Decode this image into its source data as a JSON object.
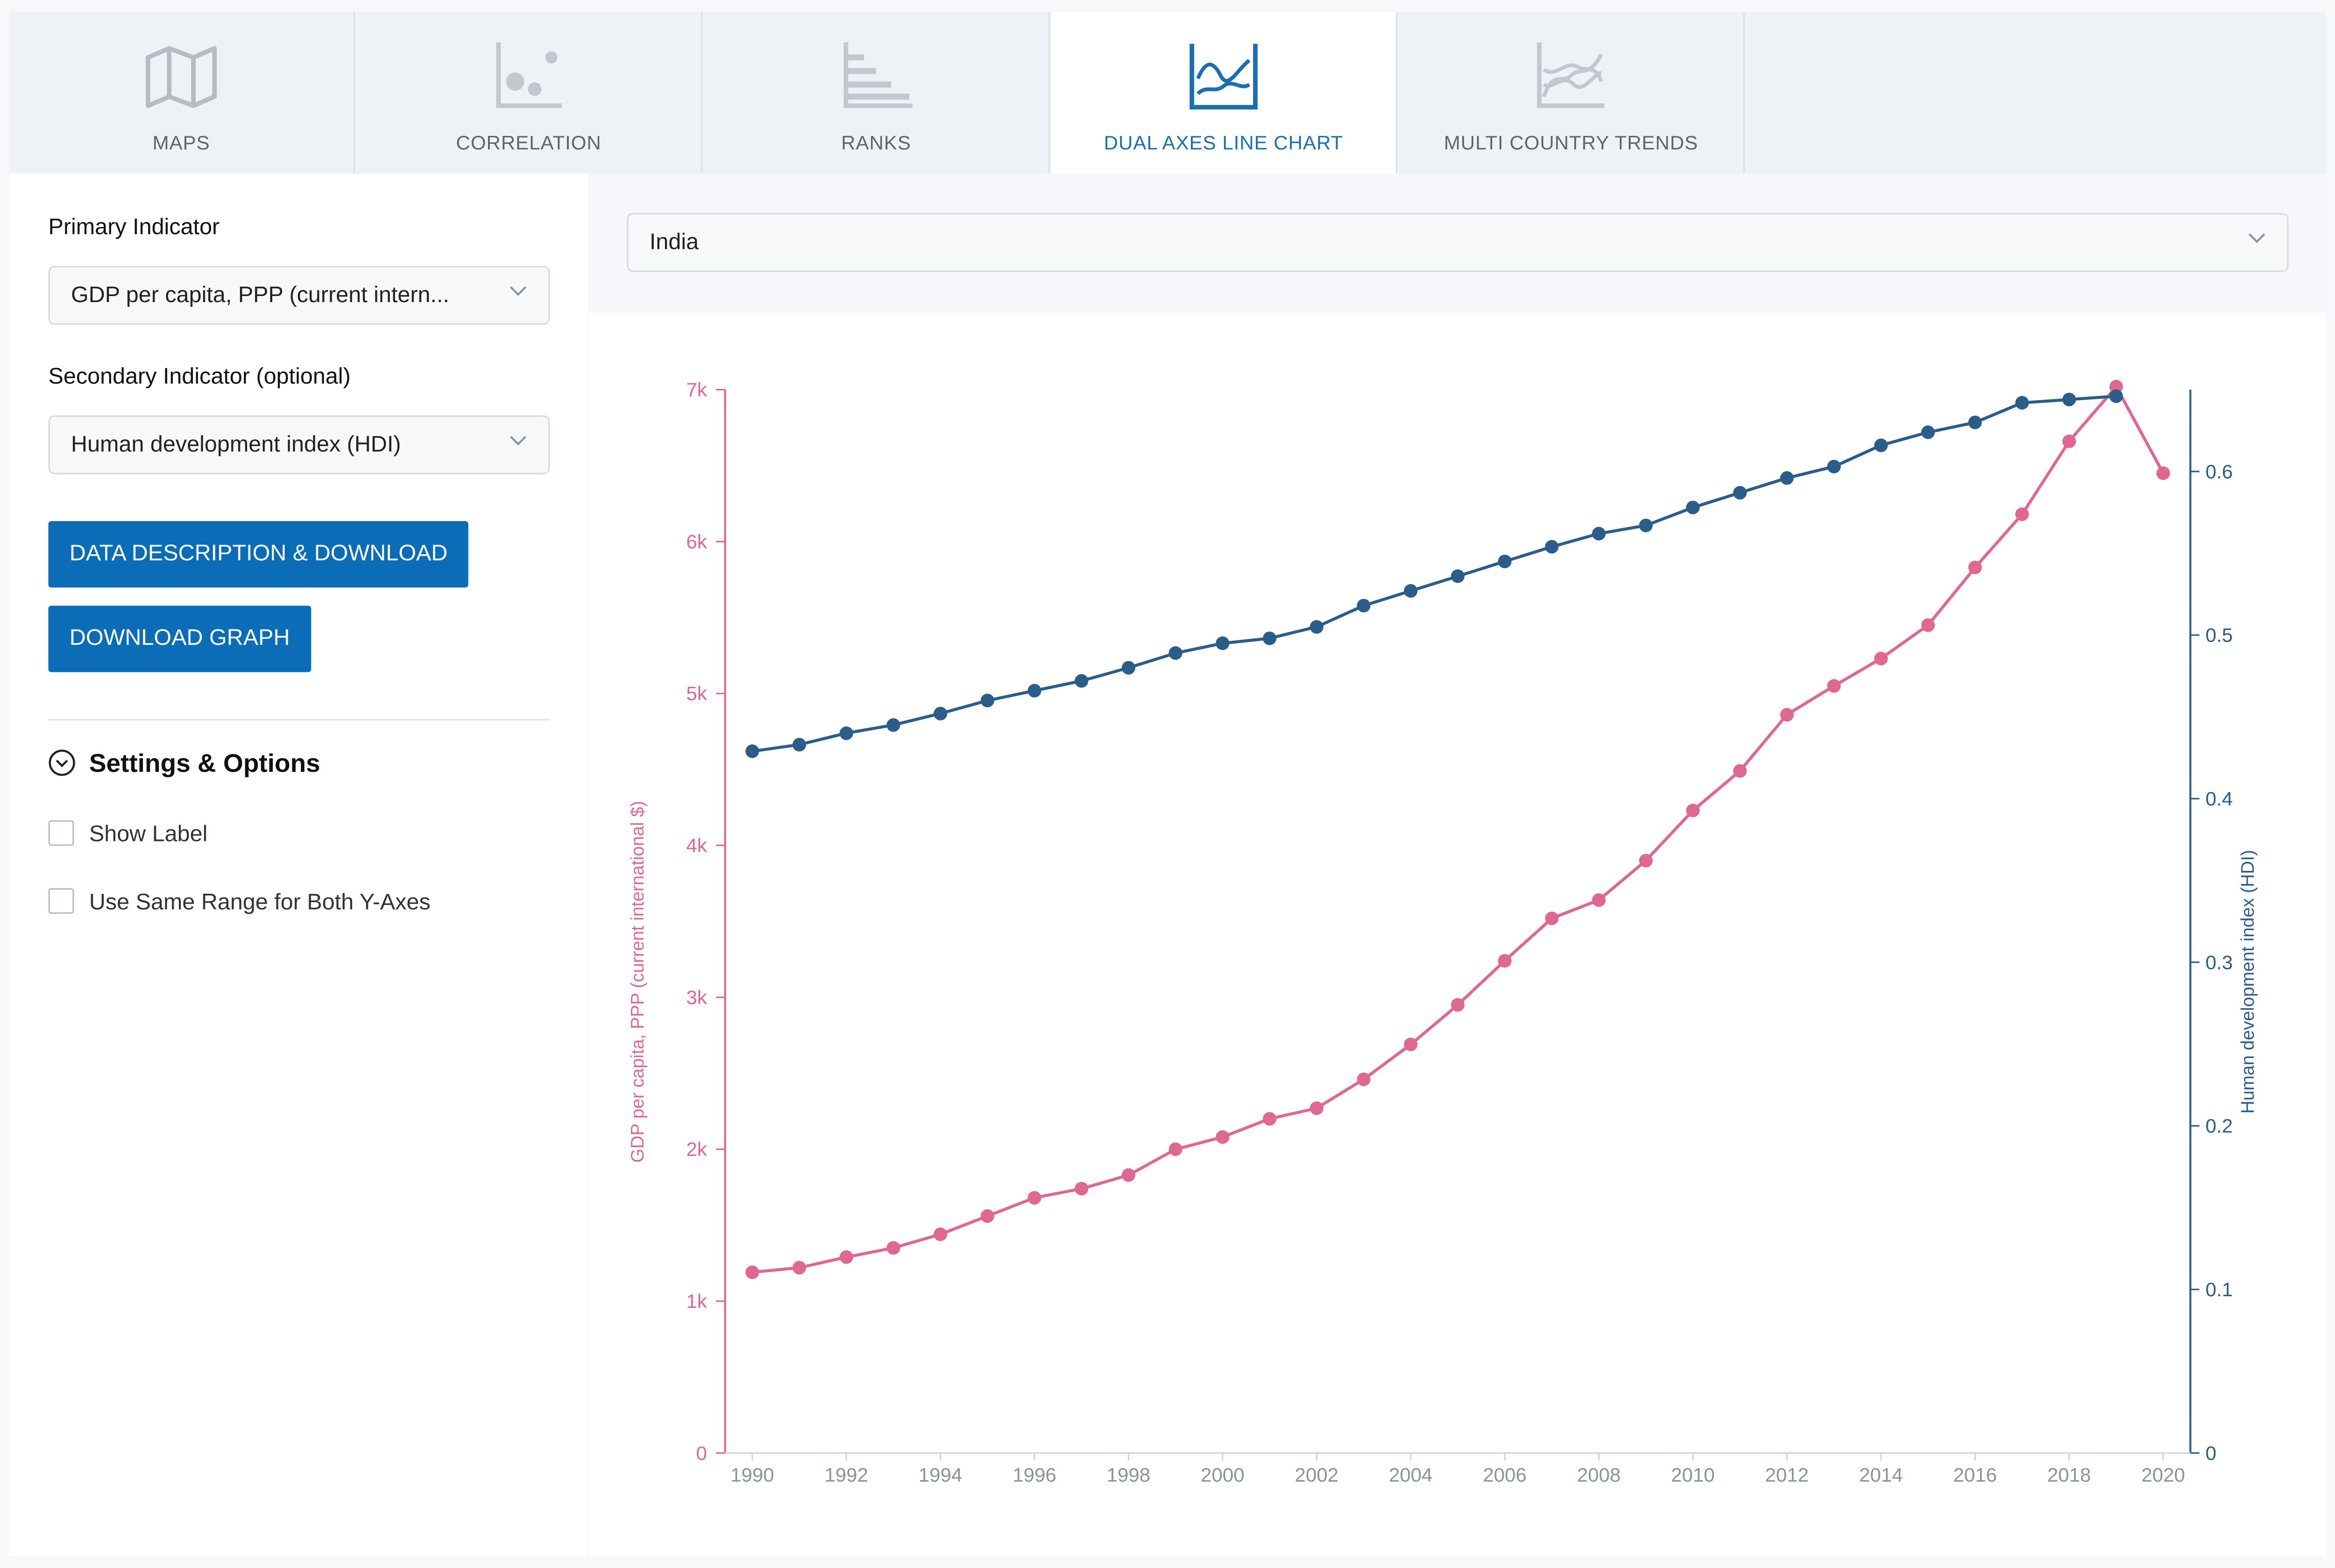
{
  "tabs": [
    {
      "label": "MAPS",
      "icon": "map-icon"
    },
    {
      "label": "CORRELATION",
      "icon": "scatter-icon"
    },
    {
      "label": "RANKS",
      "icon": "ranks-icon"
    },
    {
      "label": "DUAL AXES LINE CHART",
      "icon": "dual-axes-line-chart-icon",
      "active": true
    },
    {
      "label": "MULTI COUNTRY TRENDS",
      "icon": "multi-trend-icon"
    }
  ],
  "sidebar": {
    "primary_label": "Primary Indicator",
    "primary_value": "GDP per capita, PPP (current intern...",
    "secondary_label": "Secondary Indicator (optional)",
    "secondary_value": "Human development index (HDI)",
    "btn_description": "DATA DESCRIPTION & DOWNLOAD",
    "btn_download": "DOWNLOAD GRAPH",
    "settings_title": "Settings & Options",
    "opt_show_label": "Show Label",
    "opt_same_range": "Use Same Range for Both Y-Axes"
  },
  "country": {
    "selected": "India"
  },
  "colors": {
    "accent": "#0b6db8",
    "primary_series": "#e06890",
    "secondary_series": "#2a5d8a"
  },
  "chart_data": {
    "type": "line",
    "title": "",
    "x": [
      1990,
      1991,
      1992,
      1993,
      1994,
      1995,
      1996,
      1997,
      1998,
      1999,
      2000,
      2001,
      2002,
      2003,
      2004,
      2005,
      2006,
      2007,
      2008,
      2009,
      2010,
      2011,
      2012,
      2013,
      2014,
      2015,
      2016,
      2017,
      2018,
      2019,
      2020
    ],
    "xticks": [
      "1990",
      "1992",
      "1994",
      "1996",
      "1998",
      "2000",
      "2002",
      "2004",
      "2006",
      "2008",
      "2010",
      "2012",
      "2014",
      "2016",
      "2018",
      "2020"
    ],
    "xlim": [
      1990,
      2020
    ],
    "series": [
      {
        "name": "GDP per capita, PPP (current international $)",
        "axis": "left",
        "color": "#e06890",
        "values": [
          1190,
          1220,
          1290,
          1350,
          1440,
          1560,
          1680,
          1740,
          1830,
          2000,
          2080,
          2200,
          2270,
          2460,
          2690,
          2950,
          3240,
          3520,
          3640,
          3900,
          4230,
          4490,
          4860,
          5050,
          5230,
          5450,
          5830,
          6180,
          6660,
          7020,
          6450
        ]
      },
      {
        "name": "Human development index (HDI)",
        "axis": "right",
        "color": "#2a5d8a",
        "values": [
          0.429,
          0.433,
          0.44,
          0.445,
          0.452,
          0.46,
          0.466,
          0.472,
          0.48,
          0.489,
          0.495,
          0.498,
          0.505,
          0.518,
          0.527,
          0.536,
          0.545,
          0.554,
          0.562,
          0.567,
          0.578,
          0.587,
          0.596,
          0.603,
          0.616,
          0.624,
          0.63,
          0.642,
          0.644,
          0.646
        ]
      }
    ],
    "y_left": {
      "label": "GDP per capita, PPP (current international $)",
      "ylim": [
        0,
        7000
      ],
      "ticks": [
        0,
        1000,
        2000,
        3000,
        4000,
        5000,
        6000,
        7000
      ],
      "tick_labels": [
        "0",
        "1k",
        "2k",
        "3k",
        "4k",
        "5k",
        "6k",
        "7k"
      ]
    },
    "y_right": {
      "label": "Human development index (HDI)",
      "ylim": [
        0,
        0.65
      ],
      "ticks": [
        0,
        0.1,
        0.2,
        0.3,
        0.4,
        0.5,
        0.6
      ],
      "tick_labels": [
        "0",
        "0.1",
        "0.2",
        "0.3",
        "0.4",
        "0.5",
        "0.6"
      ]
    },
    "grid": false,
    "legend": "none"
  }
}
